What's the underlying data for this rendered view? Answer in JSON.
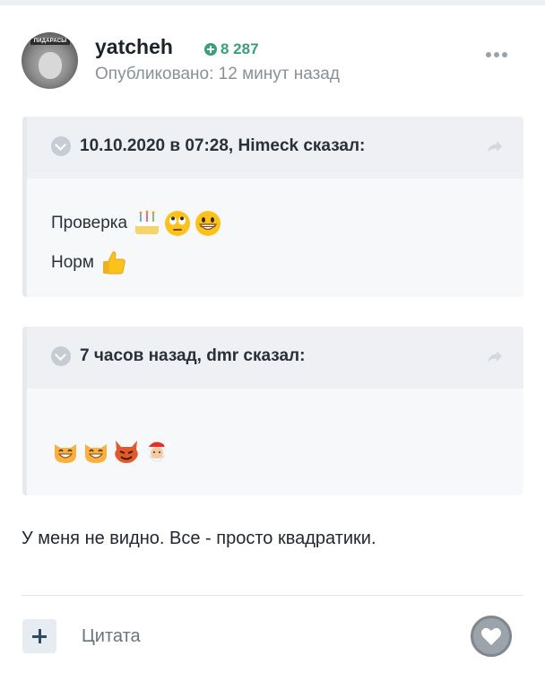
{
  "post": {
    "author": "yatcheh",
    "avatar_caption": "ПИДАРАСЫ",
    "reputation": "8 287",
    "published": "Опубликовано: 12 минут назад",
    "icons": {
      "reputation": "plus-circle-icon",
      "menu": "more-horizontal-icon"
    }
  },
  "quotes": [
    {
      "cite": "10.10.2020 в 07:28, Himeck сказал:",
      "lines": [
        {
          "text": "Проверка",
          "emojis": [
            "birthday-cake",
            "rolling-eyes-face",
            "grinning-face"
          ]
        },
        {
          "text": "Норм",
          "emojis": [
            "thumbs-up"
          ]
        }
      ]
    },
    {
      "cite": "7 часов назад, dmr сказал:",
      "lines": [
        {
          "text": "",
          "emojis": [
            "grinning-cat",
            "grinning-cat",
            "smiling-devil",
            "santa-claus"
          ]
        }
      ]
    }
  ],
  "message": "У меня не видно. Все - просто квадратики.",
  "footer": {
    "quote_label": "Цитата",
    "icons": {
      "add": "plus-icon",
      "like": "heart-icon"
    }
  },
  "colors": {
    "reputation": "#3aa07a",
    "accent": "#2e4a66",
    "quote_bg": "#f7f8fa"
  }
}
